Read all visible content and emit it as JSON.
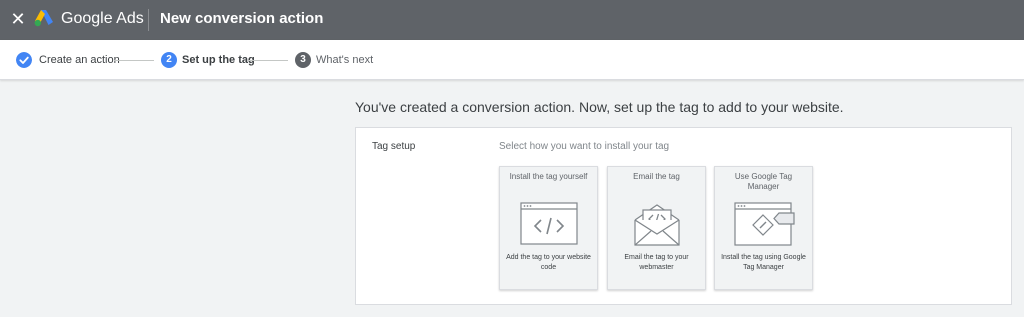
{
  "header": {
    "close_icon": "close-icon",
    "logo_icon": "google-ads-logo-icon",
    "brand": "Google Ads",
    "title": "New conversion action"
  },
  "stepper": {
    "steps": [
      {
        "label": "Create an action",
        "state": "completed",
        "icon": "check-circle-icon"
      },
      {
        "number": "2",
        "label": "Set up the tag",
        "state": "current"
      },
      {
        "number": "3",
        "label": "What's next",
        "state": "upcoming"
      }
    ]
  },
  "main": {
    "heading": "You've created a conversion action. Now, set up the tag to add to your website.",
    "section_label": "Tag setup",
    "instruction": "Select how you want to install your tag",
    "options": [
      {
        "title": "Install the tag yourself",
        "description": "Add the tag to your website code",
        "icon": "code-window-icon"
      },
      {
        "title": "Email the tag",
        "description": "Email the tag to your webmaster",
        "icon": "email-code-icon"
      },
      {
        "title": "Use Google Tag Manager",
        "description": "Install the tag using Google Tag Manager",
        "icon": "tag-manager-icon"
      }
    ]
  },
  "colors": {
    "header_bg": "#5f6368",
    "accent_blue": "#4285f4",
    "step_upcoming": "#5f6368",
    "page_bg": "#f1f3f4"
  }
}
